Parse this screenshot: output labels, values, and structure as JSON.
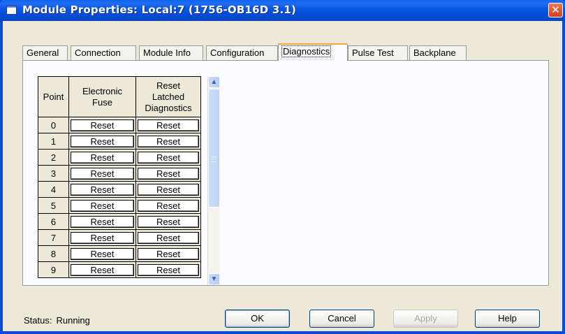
{
  "window": {
    "title": "Module Properties: Local:7 (1756-OB16D 3.1)",
    "close_glyph": "✕"
  },
  "tabs": [
    {
      "label": "General"
    },
    {
      "label": "Connection"
    },
    {
      "label": "Module Info"
    },
    {
      "label": "Configuration"
    },
    {
      "label": "Diagnostics",
      "active": true
    },
    {
      "label": "Pulse Test"
    },
    {
      "label": "Backplane"
    }
  ],
  "diagnostics_grid": {
    "headers": {
      "point": "Point",
      "fuse": [
        "Electronic",
        "Fuse"
      ],
      "latched": [
        "Reset",
        "Latched",
        "Diagnostics"
      ]
    },
    "rows": [
      {
        "point": "0",
        "fuse": "Reset",
        "latched": "Reset"
      },
      {
        "point": "1",
        "fuse": "Reset",
        "latched": "Reset"
      },
      {
        "point": "2",
        "fuse": "Reset",
        "latched": "Reset"
      },
      {
        "point": "3",
        "fuse": "Reset",
        "latched": "Reset"
      },
      {
        "point": "4",
        "fuse": "Reset",
        "latched": "Reset"
      },
      {
        "point": "5",
        "fuse": "Reset",
        "latched": "Reset"
      },
      {
        "point": "6",
        "fuse": "Reset",
        "latched": "Reset"
      },
      {
        "point": "7",
        "fuse": "Reset",
        "latched": "Reset"
      },
      {
        "point": "8",
        "fuse": "Reset",
        "latched": "Reset"
      },
      {
        "point": "9",
        "fuse": "Reset",
        "latched": "Reset"
      }
    ]
  },
  "status": {
    "label": "Status:",
    "value": "Running"
  },
  "buttons": {
    "ok": "OK",
    "cancel": "Cancel",
    "apply": "Apply",
    "help": "Help"
  },
  "colors": {
    "titlebar": "#0855dd",
    "dialog_face": "#ece9d8",
    "active_tab_highlight": "#f4a63a",
    "close_button": "#d2401c"
  }
}
